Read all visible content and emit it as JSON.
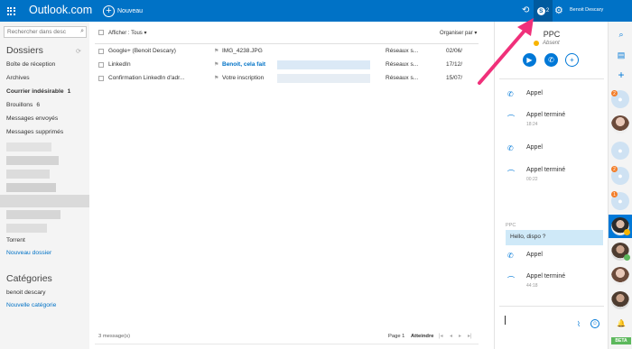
{
  "topbar": {
    "brand": "Outlook.com",
    "new_label": "Nouveau",
    "skype_count": "2",
    "user_name": "Benoit Descary"
  },
  "leftnav": {
    "search_placeholder": "Rechercher dans desc",
    "folders_heading": "Dossiers",
    "items": [
      {
        "label": "Boîte de réception",
        "count": ""
      },
      {
        "label": "Archives",
        "count": ""
      },
      {
        "label": "Courrier indésirable",
        "count": "1"
      },
      {
        "label": "Brouillons",
        "count": "6"
      },
      {
        "label": "Messages envoyés",
        "count": ""
      },
      {
        "label": "Messages supprimés",
        "count": ""
      }
    ],
    "torrent": "Torrent",
    "new_folder": "Nouveau dossier",
    "categories_heading": "Catégories",
    "category_item": "benoit descary",
    "new_category": "Nouvelle catégorie"
  },
  "msglist": {
    "filter_label": "Afficher : Tous",
    "arrange_label": "Organiser par",
    "rows": [
      {
        "sender": "Google+ (Benoit Descary)",
        "subject": "IMG_4238.JPG",
        "folder": "Réseaux s...",
        "date": "02/06/",
        "bold_subject": false
      },
      {
        "sender": "LinkedIn",
        "subject": "Benoit, cela fait",
        "folder": "Réseaux s...",
        "date": "17/12/",
        "bold_subject": true
      },
      {
        "sender": "Confirmation LinkedIn d'adr...",
        "subject": "Votre inscription",
        "folder": "Réseaux s...",
        "date": "15/07/",
        "bold_subject": false
      }
    ],
    "message_count": "3 message(s)",
    "page_label": "Page 1",
    "goto_label": "Atteindre"
  },
  "skype": {
    "contact_name": "PPC",
    "status": "Absent",
    "events": [
      {
        "label": "Appel",
        "time": "",
        "type": "call"
      },
      {
        "label": "Appel terminé",
        "time": "18:24",
        "type": "end"
      },
      {
        "label": "Appel",
        "time": "",
        "type": "call"
      },
      {
        "label": "Appel terminé",
        "time": "00:22",
        "type": "end"
      }
    ],
    "msg_sender": "PPC",
    "msg_text": "Hello, dispo ?",
    "events2": [
      {
        "label": "Appel",
        "time": "",
        "type": "call"
      },
      {
        "label": "Appel terminé",
        "time": "44:18",
        "type": "end"
      }
    ]
  },
  "rail": {
    "beta": "BETA",
    "badges": [
      "2",
      "2",
      "1"
    ]
  },
  "colors": {
    "brand_blue": "#0072c6",
    "skype_blue": "#0078d7",
    "arrow_pink": "#f0307a"
  }
}
